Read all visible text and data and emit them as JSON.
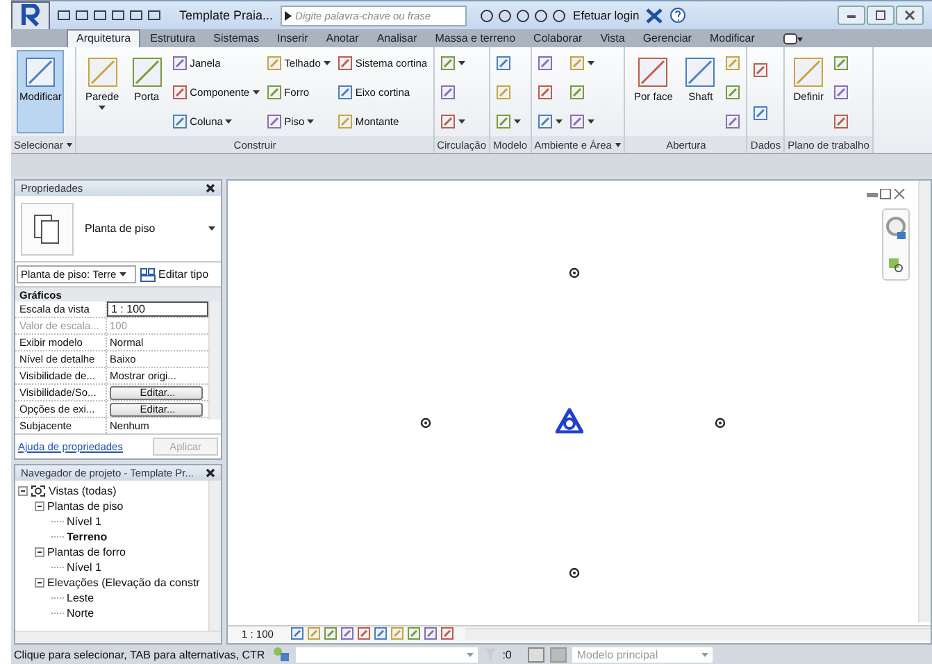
{
  "title_bar": {
    "title": "Template Praia...",
    "search": {
      "placeholder": "Digite palavra-chave ou frase"
    },
    "login": "Efetuar login"
  },
  "tabs": [
    {
      "label": "Arquitetura",
      "selected": true
    },
    {
      "label": "Estrutura",
      "selected": false
    },
    {
      "label": "Sistemas",
      "selected": false
    },
    {
      "label": "Inserir",
      "selected": false
    },
    {
      "label": "Anotar",
      "selected": false
    },
    {
      "label": "Analisar",
      "selected": false
    },
    {
      "label": "Massa e terreno",
      "selected": false
    },
    {
      "label": "Colaborar",
      "selected": false
    },
    {
      "label": "Vista",
      "selected": false
    },
    {
      "label": "Gerenciar",
      "selected": false
    },
    {
      "label": "Modificar",
      "selected": false
    }
  ],
  "ribbon": [
    {
      "title": "Selecionar",
      "menu": true,
      "items": [
        {
          "kind": "large",
          "label": "Modificar",
          "selected": true,
          "dropdown": false
        }
      ]
    },
    {
      "title": "Construir",
      "menu": false,
      "items": [
        {
          "kind": "large",
          "label": "Parede",
          "dropdown": true
        },
        {
          "kind": "large",
          "label": "Porta",
          "dropdown": false
        },
        {
          "kind": "stack",
          "items": [
            {
              "label": "Janela",
              "dropdown": false
            },
            {
              "label": "Componente",
              "dropdown": true
            },
            {
              "label": "Coluna",
              "dropdown": true
            }
          ]
        },
        {
          "kind": "stack",
          "items": [
            {
              "label": "Telhado",
              "dropdown": true
            },
            {
              "label": "Forro",
              "dropdown": false
            },
            {
              "label": "Piso",
              "dropdown": true
            }
          ]
        },
        {
          "kind": "stack",
          "items": [
            {
              "label": "Sistema cortina",
              "dropdown": false
            },
            {
              "label": "Eixo cortina",
              "dropdown": false
            },
            {
              "label": "Montante",
              "dropdown": false
            }
          ]
        }
      ]
    },
    {
      "title": "Circulação",
      "menu": false,
      "items": [
        {
          "kind": "stack",
          "items": [
            {
              "dropdown": true
            },
            {
              "dropdown": false
            },
            {
              "dropdown": true
            }
          ]
        }
      ]
    },
    {
      "title": "Modelo",
      "menu": false,
      "items": [
        {
          "kind": "stack",
          "items": [
            {
              "dropdown": false
            },
            {
              "dropdown": false
            },
            {
              "dropdown": true
            }
          ]
        }
      ]
    },
    {
      "title": "Ambiente e Área",
      "menu": true,
      "items": [
        {
          "kind": "stack",
          "items": [
            {
              "dropdown": false
            },
            {
              "dropdown": false
            },
            {
              "dropdown": true
            }
          ]
        },
        {
          "kind": "stack",
          "items": [
            {
              "dropdown": true
            },
            {
              "dropdown": false
            },
            {
              "dropdown": true
            }
          ]
        }
      ]
    },
    {
      "title": "Abertura",
      "menu": false,
      "items": [
        {
          "kind": "large",
          "label": "Por face",
          "dropdown": false
        },
        {
          "kind": "large",
          "label": "Shaft",
          "dropdown": false
        },
        {
          "kind": "stack",
          "items": [
            {
              "dropdown": false
            },
            {
              "dropdown": false
            },
            {
              "dropdown": false
            }
          ]
        }
      ]
    },
    {
      "title": "Dados",
      "menu": false,
      "items": [
        {
          "kind": "stack",
          "items": [
            {
              "dropdown": false
            },
            {
              "dropdown": false
            }
          ]
        }
      ]
    },
    {
      "title": "Plano de trabalho",
      "menu": false,
      "items": [
        {
          "kind": "large",
          "label": "Definir",
          "dropdown": false
        },
        {
          "kind": "stack",
          "items": [
            {
              "dropdown": false
            },
            {
              "dropdown": false
            },
            {
              "dropdown": false
            }
          ]
        }
      ]
    }
  ],
  "properties": {
    "title": "Propriedades",
    "type": "Planta de piso",
    "selector": "Planta de piso: Terre",
    "edit_type": "Editar tipo",
    "group": "Gráficos",
    "rows": [
      {
        "name": "Escala da vista",
        "value": "1 : 100",
        "kind": "field",
        "disabled": false
      },
      {
        "name": "Valor de escala...",
        "value": "100",
        "kind": "text",
        "disabled": true
      },
      {
        "name": "Exibir modelo",
        "value": "Normal",
        "kind": "text",
        "disabled": false
      },
      {
        "name": "Nível de detalhe",
        "value": "Baixo",
        "kind": "text",
        "disabled": false
      },
      {
        "name": "Visibilidade de...",
        "value": "Mostrar origi...",
        "kind": "text",
        "disabled": false
      },
      {
        "name": "Visibilidade/So...",
        "value": "Editar...",
        "kind": "button",
        "disabled": false
      },
      {
        "name": "Opções de exi...",
        "value": "Editar...",
        "kind": "button",
        "disabled": false
      },
      {
        "name": "Subjacente",
        "value": "Nenhum",
        "kind": "text",
        "disabled": false
      }
    ],
    "help_link": "Ajuda de propriedades",
    "apply": {
      "label": "Aplicar",
      "disabled": true
    }
  },
  "navigator": {
    "title": "Navegador de projeto - Template Pr...",
    "tree": [
      {
        "label": "Vistas (todas)",
        "expanded": true,
        "selected": false,
        "children": [
          {
            "label": "Plantas de piso",
            "expanded": true,
            "selected": false,
            "children": [
              {
                "label": "Nível 1",
                "selected": false
              },
              {
                "label": "Terreno",
                "selected": true
              }
            ]
          },
          {
            "label": "Plantas de forro",
            "expanded": true,
            "selected": false,
            "children": [
              {
                "label": "Nível 1",
                "selected": false
              }
            ]
          },
          {
            "label": "Elevações (Elevação da constr",
            "expanded": true,
            "selected": false,
            "children": [
              {
                "label": "Leste",
                "selected": false
              },
              {
                "label": "Norte",
                "selected": false
              }
            ]
          }
        ]
      }
    ]
  },
  "view_bar": {
    "scale": "1 : 100"
  },
  "status_bar": {
    "message": "Clique para selecionar, TAB para alternativas, CTR",
    "count": ":0",
    "model": {
      "placeholder": "Modelo principal"
    }
  }
}
